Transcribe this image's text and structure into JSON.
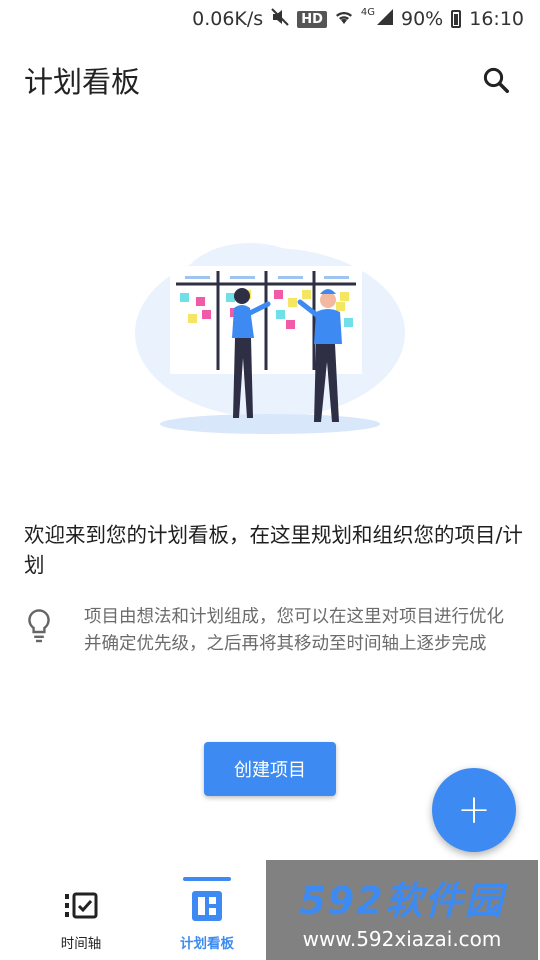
{
  "status_bar": {
    "speed": "0.06K/s",
    "hd": "HD",
    "network": "4G",
    "battery": "90%",
    "time": "16:10"
  },
  "app_bar": {
    "title": "计划看板"
  },
  "empty_state": {
    "welcome": "欢迎来到您的计划看板，在这里规划和组织您的项目/计划",
    "tip": "项目由想法和计划组成，您可以在这里对项目进行优化并确定优先级，之后再将其移动至时间轴上逐步完成",
    "create_label": "创建项目"
  },
  "fab": {
    "symbol": "+"
  },
  "bottom_nav": {
    "items": [
      {
        "label": "时间轴",
        "icon": "timeline-icon",
        "active": false
      },
      {
        "label": "计划看板",
        "icon": "board-icon",
        "active": true
      }
    ]
  },
  "watermark": {
    "title": "592软件园",
    "url": "www.592xiazai.com"
  },
  "colors": {
    "accent": "#3d8bf2",
    "text": "#222222",
    "muted": "#6b6b6b"
  }
}
